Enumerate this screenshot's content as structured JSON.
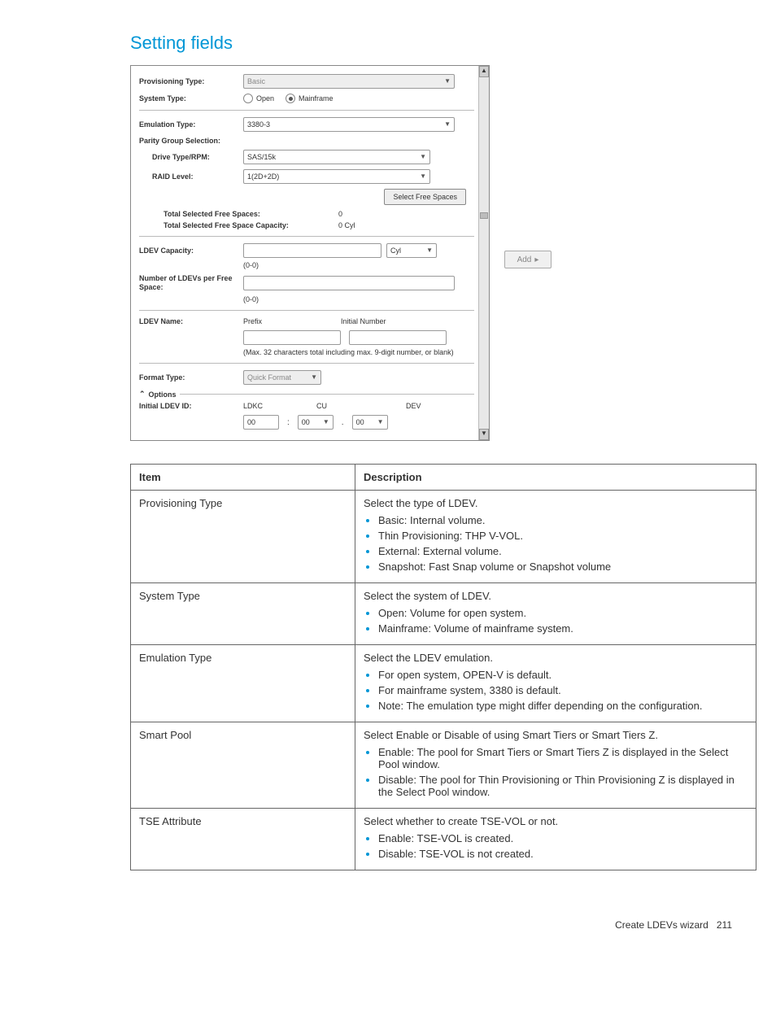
{
  "heading": "Setting fields",
  "form": {
    "provisioning_type": {
      "label": "Provisioning Type:",
      "value": "Basic"
    },
    "system_type": {
      "label": "System Type:",
      "open": "Open",
      "mainframe": "Mainframe"
    },
    "emulation_type": {
      "label": "Emulation Type:",
      "value": "3380-3"
    },
    "parity_group": {
      "label": "Parity Group Selection:"
    },
    "drive_type": {
      "label": "Drive Type/RPM:",
      "value": "SAS/15k"
    },
    "raid_level": {
      "label": "RAID Level:",
      "value": "1(2D+2D)"
    },
    "select_free_spaces_btn": "Select Free Spaces",
    "total_spaces": {
      "label": "Total Selected Free Spaces:",
      "value": "0"
    },
    "total_capacity": {
      "label": "Total Selected Free Space Capacity:",
      "value": "0 Cyl"
    },
    "ldev_capacity": {
      "label": "LDEV Capacity:",
      "unit": "Cyl",
      "range": "(0-0)"
    },
    "num_ldevs": {
      "label": "Number of LDEVs per Free Space:",
      "range": "(0-0)"
    },
    "ldev_name": {
      "label": "LDEV Name:",
      "prefix": "Prefix",
      "initial": "Initial Number",
      "note": "(Max. 32 characters total including max. 9-digit number, or blank)"
    },
    "format_type": {
      "label": "Format Type:",
      "value": "Quick Format"
    },
    "options": "Options",
    "initial_ldev_id": {
      "label": "Initial LDEV ID:",
      "ldkc": "LDKC",
      "cu": "CU",
      "dev": "DEV",
      "v": "00"
    }
  },
  "add_btn": "Add",
  "table": {
    "headers": {
      "item": "Item",
      "desc": "Description"
    },
    "rows": [
      {
        "item": "Provisioning Type",
        "intro": "Select the type of LDEV.",
        "bullets": [
          "Basic: Internal volume.",
          "Thin Provisioning: THP V-VOL.",
          "External: External volume.",
          "Snapshot: Fast Snap volume or Snapshot volume"
        ]
      },
      {
        "item": "System Type",
        "intro": "Select the system of LDEV.",
        "bullets": [
          "Open: Volume for open system.",
          "Mainframe: Volume of mainframe system."
        ]
      },
      {
        "item": "Emulation Type",
        "intro": "Select the LDEV emulation.",
        "bullets": [
          "For open system, OPEN-V is default.",
          "For mainframe system, 3380 is default.",
          "Note: The emulation type might differ depending on the configuration."
        ]
      },
      {
        "item": "Smart Pool",
        "intro": "Select Enable or Disable of using Smart Tiers or Smart Tiers Z.",
        "bullets": [
          "Enable: The pool for Smart Tiers or Smart Tiers Z is displayed in the Select Pool window.",
          "Disable: The pool for Thin Provisioning or Thin Provisioning Z is displayed in the Select Pool window."
        ]
      },
      {
        "item": "TSE Attribute",
        "intro": "Select whether to create TSE-VOL or not.",
        "bullets": [
          "Enable: TSE-VOL is created.",
          "Disable: TSE-VOL is not created."
        ]
      }
    ]
  },
  "footer": {
    "text": "Create LDEVs wizard",
    "page": "211"
  }
}
